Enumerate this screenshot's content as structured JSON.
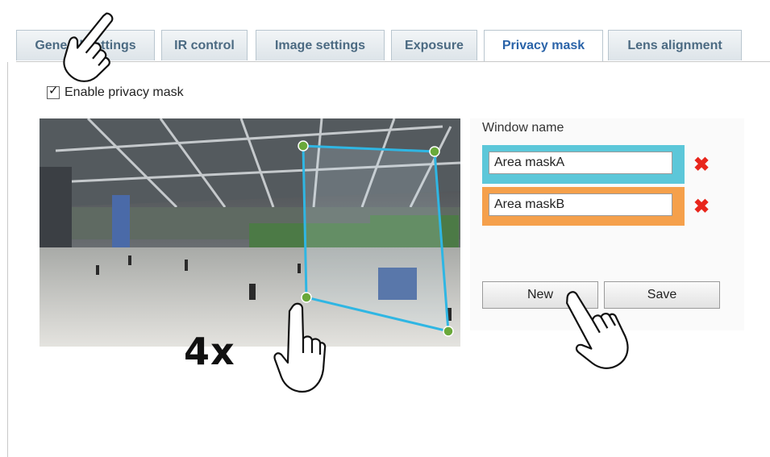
{
  "tabs": [
    {
      "label": "General settings",
      "active": false
    },
    {
      "label": "IR control",
      "active": false
    },
    {
      "label": "Image settings",
      "active": false
    },
    {
      "label": "Exposure",
      "active": false
    },
    {
      "label": "Privacy mask",
      "active": true
    },
    {
      "label": "Lens alignment",
      "active": false
    }
  ],
  "enable": {
    "label": "Enable privacy mask",
    "checked": true
  },
  "window_name_label": "Window name",
  "masks": [
    {
      "value": "Area maskA",
      "color": "#5cc7d9"
    },
    {
      "value": "Area maskB",
      "color": "#f5a04b"
    }
  ],
  "buttons": {
    "new": "New",
    "save": "Save"
  },
  "annotation": {
    "text": "4x"
  },
  "colors": {
    "mask_outline": "#2fb6e3",
    "mask_handle": "#6aa83a",
    "delete": "#e8261c",
    "tab_text": "#4b6a82",
    "tab_active_text": "#2a63a8"
  },
  "icons": [
    "pointing-hand-icon",
    "delete-x-icon"
  ]
}
